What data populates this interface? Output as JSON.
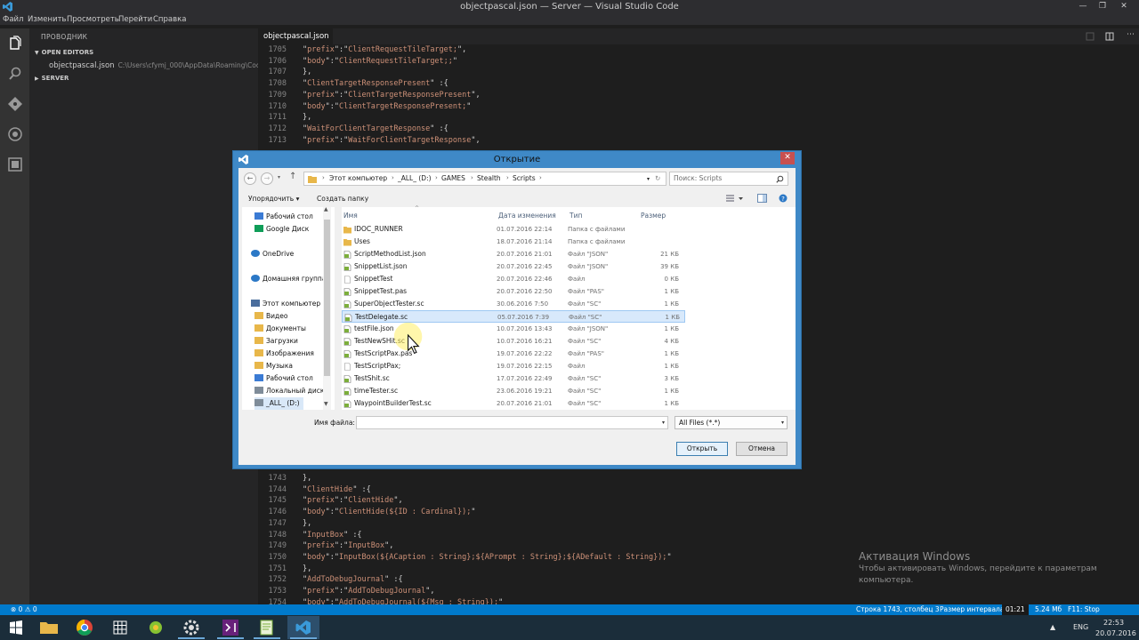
{
  "window": {
    "title": "objectpascal.json — Server — Visual Studio Code",
    "controls": [
      "—",
      "❐",
      "✕"
    ]
  },
  "menu": [
    "Файл",
    "Изменить",
    "Просмотреть",
    "Перейти",
    "Справка"
  ],
  "sidebar": {
    "title": "ПРОВОДНИК",
    "open_editors_label": "OPEN EDITORS",
    "open_editor_file": "objectpascal.json",
    "open_editor_path": "C:\\Users\\cfymj_000\\AppData\\Roaming\\Code...",
    "server_label": "SERVER"
  },
  "tab": {
    "label": "objectpascal.json"
  },
  "code_top": [
    {
      "n": "1705",
      "segs": [
        [
          "k",
          "\""
        ],
        [
          "s",
          "prefix"
        ],
        [
          "k",
          "\":\""
        ],
        [
          "s",
          "ClientRequestTileTarget;"
        ],
        [
          "k",
          "\","
        ]
      ]
    },
    {
      "n": "1706",
      "segs": [
        [
          "k",
          "\""
        ],
        [
          "s",
          "body"
        ],
        [
          "k",
          "\":\""
        ],
        [
          "s",
          "ClientRequestTileTarget;;"
        ],
        [
          "k",
          "\""
        ]
      ]
    },
    {
      "n": "1707",
      "segs": [
        [
          "k",
          "},"
        ]
      ]
    },
    {
      "n": "1708",
      "segs": [
        [
          "k",
          "\""
        ],
        [
          "s",
          "ClientTargetResponsePresent"
        ],
        [
          "k",
          "\" :{"
        ]
      ]
    },
    {
      "n": "1709",
      "segs": [
        [
          "k",
          "\""
        ],
        [
          "s",
          "prefix"
        ],
        [
          "k",
          "\":\""
        ],
        [
          "s",
          "ClientTargetResponsePresent"
        ],
        [
          "k",
          "\","
        ]
      ]
    },
    {
      "n": "1710",
      "segs": [
        [
          "k",
          "\""
        ],
        [
          "s",
          "body"
        ],
        [
          "k",
          "\":\""
        ],
        [
          "s",
          "ClientTargetResponsePresent;"
        ],
        [
          "k",
          "\""
        ]
      ]
    },
    {
      "n": "1711",
      "segs": [
        [
          "k",
          "},"
        ]
      ]
    },
    {
      "n": "1712",
      "segs": [
        [
          "k",
          "\""
        ],
        [
          "s",
          "WaitForClientTargetResponse"
        ],
        [
          "k",
          "\" :{"
        ]
      ]
    },
    {
      "n": "1713",
      "segs": [
        [
          "k",
          "\""
        ],
        [
          "s",
          "prefix"
        ],
        [
          "k",
          "\":\""
        ],
        [
          "s",
          "WaitForClientTargetResponse"
        ],
        [
          "k",
          "\","
        ]
      ]
    }
  ],
  "code_bottom": [
    {
      "n": "1743",
      "segs": [
        [
          "k",
          "},"
        ]
      ]
    },
    {
      "n": "1744",
      "segs": [
        [
          "k",
          "\""
        ],
        [
          "s",
          "ClientHide"
        ],
        [
          "k",
          "\" :{"
        ]
      ]
    },
    {
      "n": "1745",
      "segs": [
        [
          "k",
          "\""
        ],
        [
          "s",
          "prefix"
        ],
        [
          "k",
          "\":\""
        ],
        [
          "s",
          "ClientHide"
        ],
        [
          "k",
          "\","
        ]
      ]
    },
    {
      "n": "1746",
      "segs": [
        [
          "k",
          "\""
        ],
        [
          "s",
          "body"
        ],
        [
          "k",
          "\":\""
        ],
        [
          "s",
          "ClientHide(${ID : Cardinal});"
        ],
        [
          "k",
          "\""
        ]
      ]
    },
    {
      "n": "1747",
      "segs": [
        [
          "k",
          "},"
        ]
      ]
    },
    {
      "n": "1748",
      "segs": [
        [
          "k",
          "\""
        ],
        [
          "s",
          "InputBox"
        ],
        [
          "k",
          "\" :{"
        ]
      ]
    },
    {
      "n": "1749",
      "segs": [
        [
          "k",
          "\""
        ],
        [
          "s",
          "prefix"
        ],
        [
          "k",
          "\":\""
        ],
        [
          "s",
          "InputBox"
        ],
        [
          "k",
          "\","
        ]
      ]
    },
    {
      "n": "1750",
      "segs": [
        [
          "k",
          "\""
        ],
        [
          "s",
          "body"
        ],
        [
          "k",
          "\":\""
        ],
        [
          "s",
          "InputBox(${ACaption : String};${APrompt : String};${ADefault : String});"
        ],
        [
          "k",
          "\""
        ]
      ]
    },
    {
      "n": "1751",
      "segs": [
        [
          "k",
          "},"
        ]
      ]
    },
    {
      "n": "1752",
      "segs": [
        [
          "k",
          "\""
        ],
        [
          "s",
          "AddToDebugJournal"
        ],
        [
          "k",
          "\" :{"
        ]
      ]
    },
    {
      "n": "1753",
      "segs": [
        [
          "k",
          "\""
        ],
        [
          "s",
          "prefix"
        ],
        [
          "k",
          "\":\""
        ],
        [
          "s",
          "AddToDebugJournal"
        ],
        [
          "k",
          "\","
        ]
      ]
    },
    {
      "n": "1754",
      "segs": [
        [
          "k",
          "\""
        ],
        [
          "s",
          "body"
        ],
        [
          "k",
          "\":\""
        ],
        [
          "s",
          "AddToDebugJournal(${Msg : String});"
        ],
        [
          "k",
          "\""
        ]
      ]
    }
  ],
  "activation": {
    "title": "Активация Windows",
    "text": "Чтобы активировать Windows, перейдите к параметрам компьютера."
  },
  "statusbar": {
    "problems": "⊗ 0  ⚠ 0",
    "position": "Строка 1743, столбец 3",
    "indent": "Размер интервала",
    "time": "01:21",
    "size": "5.24 Мб",
    "stop": "F11: Stop"
  },
  "taskbar": {
    "lang": "ENG",
    "clock_time": "22:53",
    "clock_date": "20.07.2016"
  },
  "dialog": {
    "title": "Открытие",
    "breadcrumbs": [
      "Этот компьютер",
      "_ALL_ (D:)",
      "GAMES",
      "Stealth",
      "Scripts"
    ],
    "search_placeholder": "Поиск: Scripts",
    "organize": "Упорядочить ▾",
    "new_folder": "Создать папку",
    "nav_items": [
      {
        "label": "Рабочий стол",
        "icon": "desktop-icon"
      },
      {
        "label": "Google Диск",
        "icon": "google-drive-icon"
      },
      {
        "label": "OneDrive",
        "icon": "onedrive-icon"
      },
      {
        "label": "Домашняя группа",
        "icon": "homegroup-icon"
      },
      {
        "label": "Этот компьютер",
        "icon": "computer-icon"
      },
      {
        "label": "Видео",
        "icon": "video-folder-icon"
      },
      {
        "label": "Документы",
        "icon": "documents-folder-icon"
      },
      {
        "label": "Загрузки",
        "icon": "downloads-folder-icon"
      },
      {
        "label": "Изображения",
        "icon": "pictures-folder-icon"
      },
      {
        "label": "Музыка",
        "icon": "music-folder-icon"
      },
      {
        "label": "Рабочий стол",
        "icon": "desktop-icon"
      },
      {
        "label": "Локальный диск",
        "icon": "drive-icon"
      },
      {
        "label": "_ALL_ (D:)",
        "icon": "drive-icon"
      }
    ],
    "columns": {
      "name": "Имя",
      "date": "Дата изменения",
      "type": "Тип",
      "size": "Размер"
    },
    "files": [
      {
        "name": "IDOC_RUNNER",
        "date": "01.07.2016 22:14",
        "type": "Папка с файлами",
        "size": "",
        "kind": "folder"
      },
      {
        "name": "Uses",
        "date": "18.07.2016 21:14",
        "type": "Папка с файлами",
        "size": "",
        "kind": "folder"
      },
      {
        "name": "ScriptMethodList.json",
        "date": "20.07.2016 21:01",
        "type": "Файл \"JSON\"",
        "size": "21 КБ",
        "kind": "file"
      },
      {
        "name": "SnippetList.json",
        "date": "20.07.2016 22:45",
        "type": "Файл \"JSON\"",
        "size": "39 КБ",
        "kind": "file"
      },
      {
        "name": "SnippetTest",
        "date": "20.07.2016 22:46",
        "type": "Файл",
        "size": "0 КБ",
        "kind": "blank"
      },
      {
        "name": "SnippetTest.pas",
        "date": "20.07.2016 22:50",
        "type": "Файл \"PAS\"",
        "size": "1 КБ",
        "kind": "file"
      },
      {
        "name": "SuperObjectTester.sc",
        "date": "30.06.2016 7:50",
        "type": "Файл \"SC\"",
        "size": "1 КБ",
        "kind": "file"
      },
      {
        "name": "TestDelegate.sc",
        "date": "05.07.2016 7:39",
        "type": "Файл \"SC\"",
        "size": "1 КБ",
        "kind": "file"
      },
      {
        "name": "testFile.json",
        "date": "10.07.2016 13:43",
        "type": "Файл \"JSON\"",
        "size": "1 КБ",
        "kind": "file"
      },
      {
        "name": "TestNewSHit.sc",
        "date": "10.07.2016 16:21",
        "type": "Файл \"SC\"",
        "size": "4 КБ",
        "kind": "file"
      },
      {
        "name": "TestScriptPax.pas",
        "date": "19.07.2016 22:22",
        "type": "Файл \"PAS\"",
        "size": "1 КБ",
        "kind": "file"
      },
      {
        "name": "TestScriptPax;",
        "date": "19.07.2016 22:15",
        "type": "Файл",
        "size": "1 КБ",
        "kind": "blank"
      },
      {
        "name": "TestShit.sc",
        "date": "17.07.2016 22:49",
        "type": "Файл \"SC\"",
        "size": "3 КБ",
        "kind": "file"
      },
      {
        "name": "timeTester.sc",
        "date": "23.06.2016 19:21",
        "type": "Файл \"SC\"",
        "size": "1 КБ",
        "kind": "file"
      },
      {
        "name": "WaypointBuilderTest.sc",
        "date": "20.07.2016 21:01",
        "type": "Файл \"SC\"",
        "size": "1 КБ",
        "kind": "file"
      }
    ],
    "selected_file": "TestDelegate.sc",
    "filename_label": "Имя файла:",
    "filename_value": "",
    "filter": "All Files (*.*)",
    "open_button": "Открыть",
    "cancel_button": "Отмена"
  },
  "colors": {
    "accent": "#007acc",
    "dialog_frame": "#3f89c7",
    "selection": "#d8e9fb",
    "string": "#ce9178"
  }
}
